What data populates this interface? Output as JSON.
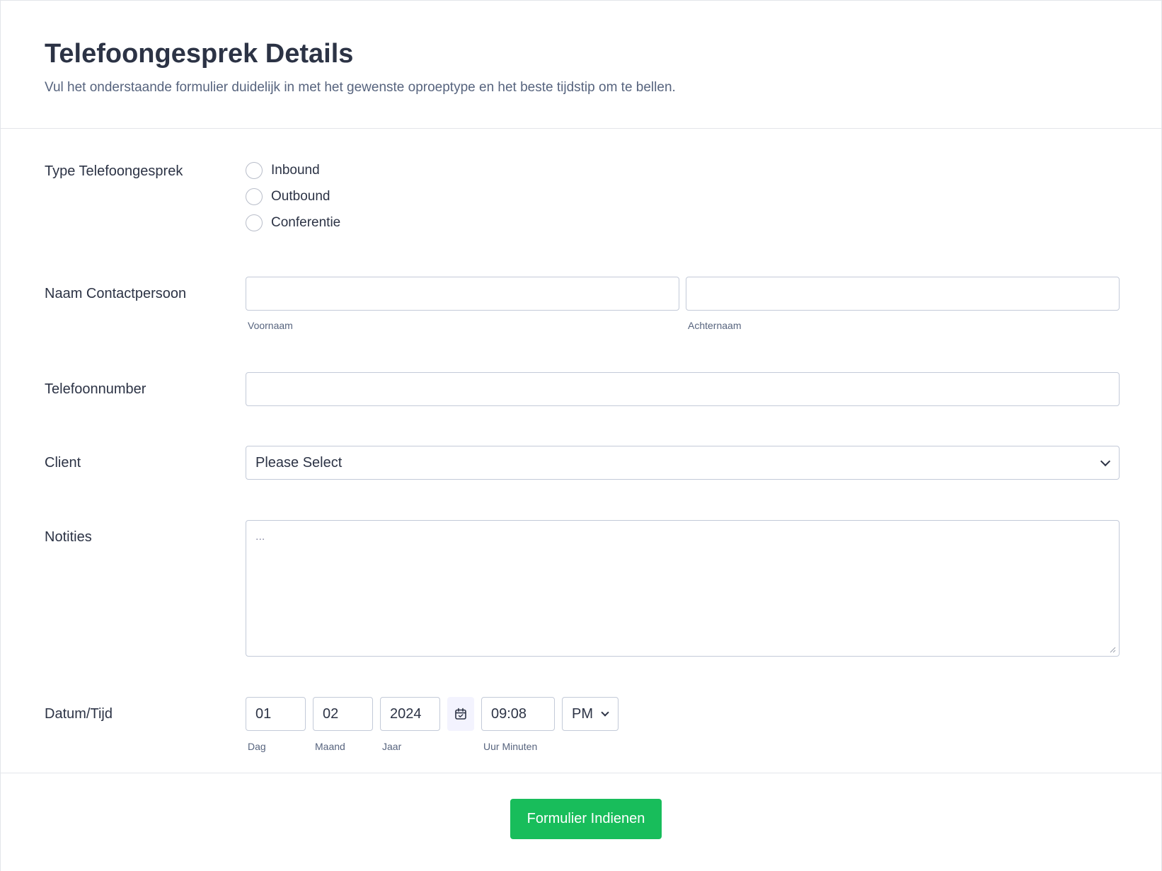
{
  "header": {
    "title": "Telefoongesprek Details",
    "subtitle": "Vul het onderstaande formulier duidelijk in met het gewenste oproeptype en het beste tijdstip om te bellen."
  },
  "call_type": {
    "label": "Type Telefoongesprek",
    "options": [
      "Inbound",
      "Outbound",
      "Conferentie"
    ]
  },
  "contact_name": {
    "label": "Naam Contactpersoon",
    "first_value": "",
    "first_sublabel": "Voornaam",
    "last_value": "",
    "last_sublabel": "Achternaam"
  },
  "phone": {
    "label": "Telefoonnumber",
    "value": ""
  },
  "client": {
    "label": "Client",
    "selected": "Please Select"
  },
  "notes": {
    "label": "Notities",
    "placeholder": "..."
  },
  "datetime": {
    "label": "Datum/Tijd",
    "day": "01",
    "day_sublabel": "Dag",
    "month": "02",
    "month_sublabel": "Maand",
    "year": "2024",
    "year_sublabel": "Jaar",
    "time": "09:08",
    "time_sublabel": "Uur Minuten",
    "ampm": "PM"
  },
  "submit": {
    "label": "Formulier Indienen"
  },
  "colors": {
    "submit_bg": "#18bd5b",
    "text": "#2c3345",
    "muted": "#57647e",
    "border": "#c3cad8"
  }
}
